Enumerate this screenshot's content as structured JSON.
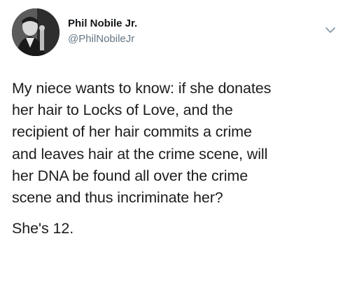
{
  "tweet": {
    "author": {
      "display_name": "Phil Nobile Jr.",
      "handle": "@PhilNobileJr",
      "avatar_icon": "profile-photo"
    },
    "menu_icon": "chevron-down-icon",
    "text_paragraph_1": "My niece wants to know: if she donates\nher hair to Locks of Love, and the\nrecipient of her hair commits a crime\nand leaves hair at the crime scene, will\nher DNA be found all over the crime\nscene and thus incriminate her?",
    "text_paragraph_2": "She's 12."
  },
  "colors": {
    "text": "#14171a",
    "secondary_text": "#657786",
    "background": "#ffffff"
  }
}
